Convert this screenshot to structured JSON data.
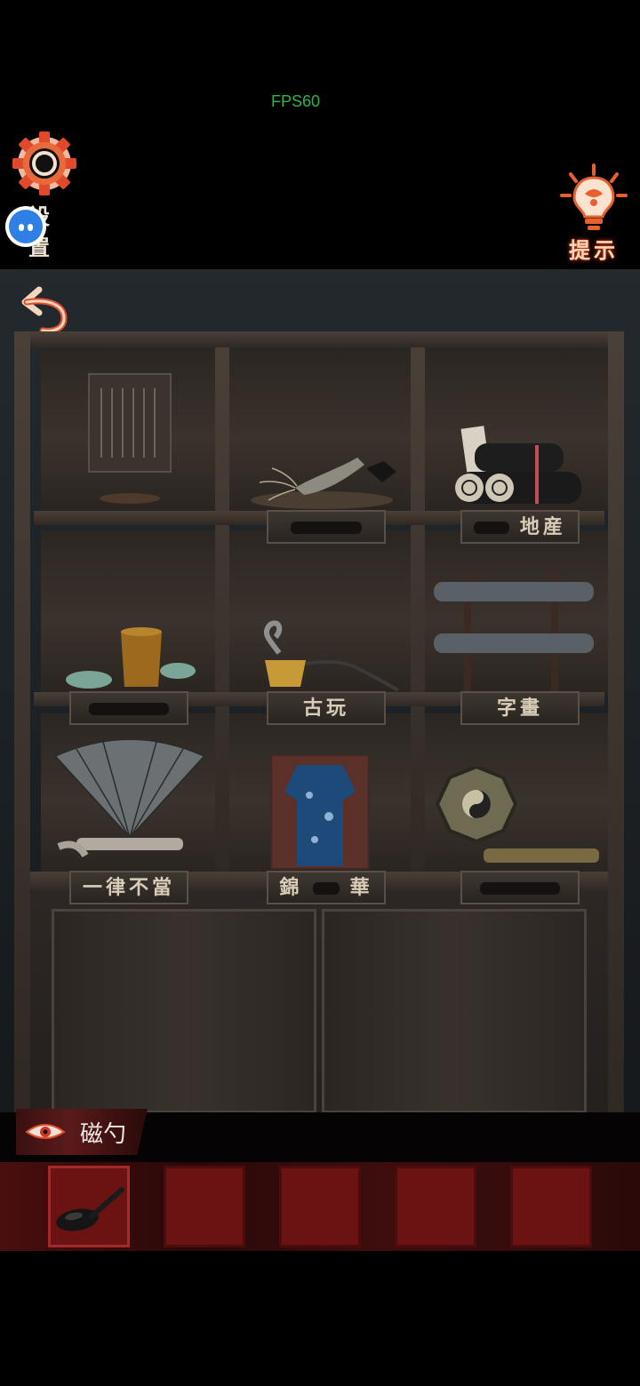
{
  "hud": {
    "fps": "FPS60",
    "settings_label": "設置",
    "hint_label": "提示"
  },
  "shelf": {
    "labels": {
      "row1_center": "",
      "row1_right": "地産",
      "row2_left": "",
      "row2_center": "古玩",
      "row2_right": "字畫",
      "row3_left": "一律不當",
      "row3_center_a": "錦",
      "row3_center_b": "華",
      "row3_right": ""
    }
  },
  "inventory": {
    "selected_item_name": "磁勺",
    "slots": [
      {
        "item": "spoon",
        "selected": true
      },
      {
        "item": "",
        "selected": false
      },
      {
        "item": "",
        "selected": false
      },
      {
        "item": "",
        "selected": false
      },
      {
        "item": "",
        "selected": false
      }
    ]
  },
  "colors": {
    "accent_red": "#6b1212",
    "fps_green": "#2fb34a",
    "hint_glow": "#d43b1a"
  }
}
